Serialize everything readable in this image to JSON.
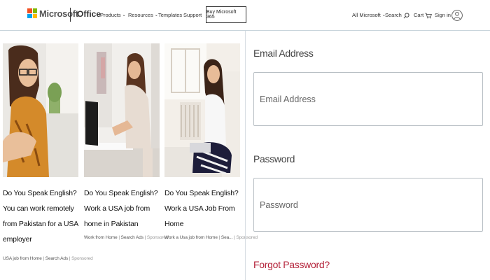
{
  "header": {
    "brand": "Microsoft",
    "product": "Office",
    "nav": [
      "Products",
      "Resources",
      "Templates",
      "Support"
    ],
    "cta": "Buy Microsoft 365",
    "all_microsoft": "All Microsoft",
    "search": "Search",
    "cart": "Cart",
    "sign_in": "Sign in"
  },
  "articles": [
    {
      "title": "Do You Speak English? You can work remotely from Pakistan for a USA employer",
      "meta": [
        "USA job from Home",
        "Search Ads",
        "Sponsored"
      ]
    },
    {
      "title": "Do You Speak English? Work a USA job from home in Pakistan",
      "meta": [
        "Work from Home",
        "Search Ads",
        "Sponsored"
      ]
    },
    {
      "title": "Do You Speak English? Work a USA Job From Home",
      "meta": [
        "Work a Usa job from Home",
        "Sea...",
        "Sponsored"
      ]
    }
  ],
  "form": {
    "email_label": "Email Address",
    "email_placeholder": "Email Address",
    "email_value": "",
    "password_label": "Password",
    "password_placeholder": "Password",
    "password_value": "",
    "forgot": "Forgot Password?"
  },
  "colors": {
    "accent_link": "#b4233a",
    "header_border": "#c8d4dc"
  }
}
